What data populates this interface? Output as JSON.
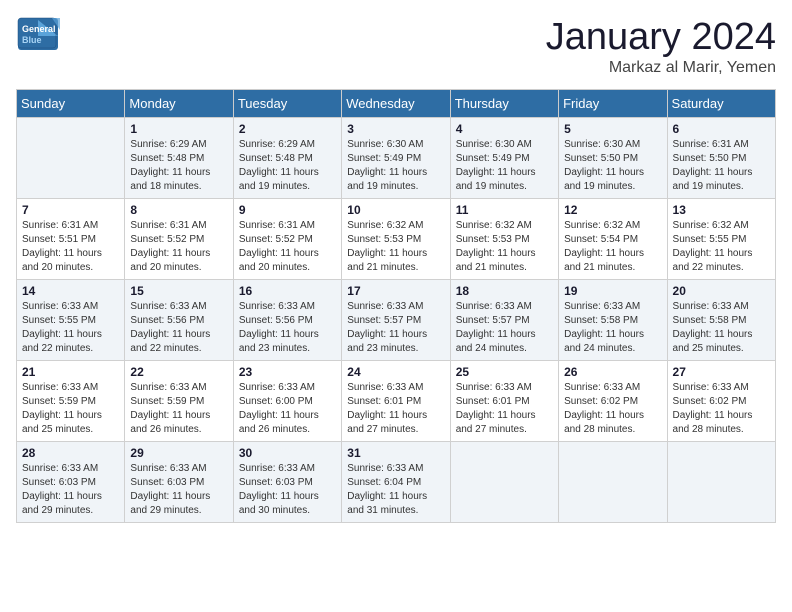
{
  "header": {
    "logo_line1": "General",
    "logo_line2": "Blue",
    "month": "January 2024",
    "location": "Markaz al Marir, Yemen"
  },
  "weekdays": [
    "Sunday",
    "Monday",
    "Tuesday",
    "Wednesday",
    "Thursday",
    "Friday",
    "Saturday"
  ],
  "weeks": [
    [
      {
        "day": "",
        "info": ""
      },
      {
        "day": "1",
        "info": "Sunrise: 6:29 AM\nSunset: 5:48 PM\nDaylight: 11 hours\nand 18 minutes."
      },
      {
        "day": "2",
        "info": "Sunrise: 6:29 AM\nSunset: 5:48 PM\nDaylight: 11 hours\nand 19 minutes."
      },
      {
        "day": "3",
        "info": "Sunrise: 6:30 AM\nSunset: 5:49 PM\nDaylight: 11 hours\nand 19 minutes."
      },
      {
        "day": "4",
        "info": "Sunrise: 6:30 AM\nSunset: 5:49 PM\nDaylight: 11 hours\nand 19 minutes."
      },
      {
        "day": "5",
        "info": "Sunrise: 6:30 AM\nSunset: 5:50 PM\nDaylight: 11 hours\nand 19 minutes."
      },
      {
        "day": "6",
        "info": "Sunrise: 6:31 AM\nSunset: 5:50 PM\nDaylight: 11 hours\nand 19 minutes."
      }
    ],
    [
      {
        "day": "7",
        "info": "Sunrise: 6:31 AM\nSunset: 5:51 PM\nDaylight: 11 hours\nand 20 minutes."
      },
      {
        "day": "8",
        "info": "Sunrise: 6:31 AM\nSunset: 5:52 PM\nDaylight: 11 hours\nand 20 minutes."
      },
      {
        "day": "9",
        "info": "Sunrise: 6:31 AM\nSunset: 5:52 PM\nDaylight: 11 hours\nand 20 minutes."
      },
      {
        "day": "10",
        "info": "Sunrise: 6:32 AM\nSunset: 5:53 PM\nDaylight: 11 hours\nand 21 minutes."
      },
      {
        "day": "11",
        "info": "Sunrise: 6:32 AM\nSunset: 5:53 PM\nDaylight: 11 hours\nand 21 minutes."
      },
      {
        "day": "12",
        "info": "Sunrise: 6:32 AM\nSunset: 5:54 PM\nDaylight: 11 hours\nand 21 minutes."
      },
      {
        "day": "13",
        "info": "Sunrise: 6:32 AM\nSunset: 5:55 PM\nDaylight: 11 hours\nand 22 minutes."
      }
    ],
    [
      {
        "day": "14",
        "info": "Sunrise: 6:33 AM\nSunset: 5:55 PM\nDaylight: 11 hours\nand 22 minutes."
      },
      {
        "day": "15",
        "info": "Sunrise: 6:33 AM\nSunset: 5:56 PM\nDaylight: 11 hours\nand 22 minutes."
      },
      {
        "day": "16",
        "info": "Sunrise: 6:33 AM\nSunset: 5:56 PM\nDaylight: 11 hours\nand 23 minutes."
      },
      {
        "day": "17",
        "info": "Sunrise: 6:33 AM\nSunset: 5:57 PM\nDaylight: 11 hours\nand 23 minutes."
      },
      {
        "day": "18",
        "info": "Sunrise: 6:33 AM\nSunset: 5:57 PM\nDaylight: 11 hours\nand 24 minutes."
      },
      {
        "day": "19",
        "info": "Sunrise: 6:33 AM\nSunset: 5:58 PM\nDaylight: 11 hours\nand 24 minutes."
      },
      {
        "day": "20",
        "info": "Sunrise: 6:33 AM\nSunset: 5:58 PM\nDaylight: 11 hours\nand 25 minutes."
      }
    ],
    [
      {
        "day": "21",
        "info": "Sunrise: 6:33 AM\nSunset: 5:59 PM\nDaylight: 11 hours\nand 25 minutes."
      },
      {
        "day": "22",
        "info": "Sunrise: 6:33 AM\nSunset: 5:59 PM\nDaylight: 11 hours\nand 26 minutes."
      },
      {
        "day": "23",
        "info": "Sunrise: 6:33 AM\nSunset: 6:00 PM\nDaylight: 11 hours\nand 26 minutes."
      },
      {
        "day": "24",
        "info": "Sunrise: 6:33 AM\nSunset: 6:01 PM\nDaylight: 11 hours\nand 27 minutes."
      },
      {
        "day": "25",
        "info": "Sunrise: 6:33 AM\nSunset: 6:01 PM\nDaylight: 11 hours\nand 27 minutes."
      },
      {
        "day": "26",
        "info": "Sunrise: 6:33 AM\nSunset: 6:02 PM\nDaylight: 11 hours\nand 28 minutes."
      },
      {
        "day": "27",
        "info": "Sunrise: 6:33 AM\nSunset: 6:02 PM\nDaylight: 11 hours\nand 28 minutes."
      }
    ],
    [
      {
        "day": "28",
        "info": "Sunrise: 6:33 AM\nSunset: 6:03 PM\nDaylight: 11 hours\nand 29 minutes."
      },
      {
        "day": "29",
        "info": "Sunrise: 6:33 AM\nSunset: 6:03 PM\nDaylight: 11 hours\nand 29 minutes."
      },
      {
        "day": "30",
        "info": "Sunrise: 6:33 AM\nSunset: 6:03 PM\nDaylight: 11 hours\nand 30 minutes."
      },
      {
        "day": "31",
        "info": "Sunrise: 6:33 AM\nSunset: 6:04 PM\nDaylight: 11 hours\nand 31 minutes."
      },
      {
        "day": "",
        "info": ""
      },
      {
        "day": "",
        "info": ""
      },
      {
        "day": "",
        "info": ""
      }
    ]
  ]
}
